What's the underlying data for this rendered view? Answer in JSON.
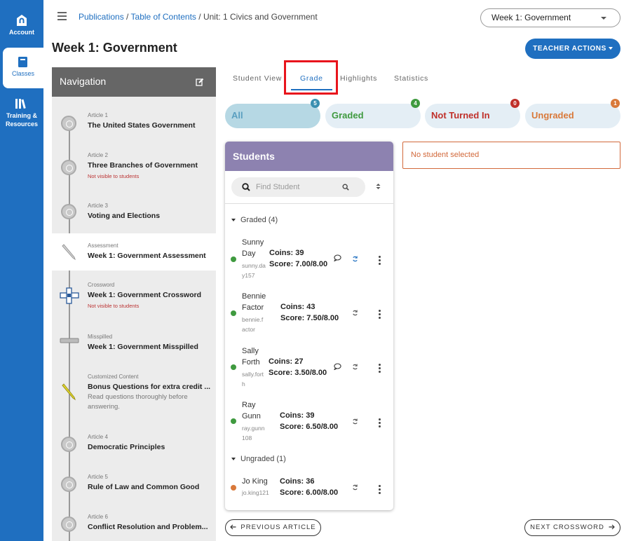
{
  "rail": {
    "items": [
      {
        "label": "Account",
        "icon": "account-icon"
      },
      {
        "label": "Classes",
        "icon": "book-icon"
      },
      {
        "label": "Training & Resources",
        "icon": "books-icon"
      }
    ]
  },
  "header": {
    "breadcrumb": {
      "link1": "Publications",
      "sep1": " / ",
      "link2": "Table of Contents",
      "sep2": " / ",
      "current": "Unit: 1 Civics and Government"
    },
    "week_select": "Week 1: Government",
    "page_title": "Week 1: Government",
    "teacher_actions": "TEACHER ACTIONS"
  },
  "navigation": {
    "title": "Navigation",
    "items": [
      {
        "type": "Article 1",
        "title": "The United States Government",
        "icon": "article-icon"
      },
      {
        "type": "Article 2",
        "title": "Three Branches of Government",
        "note": "Not visible to students",
        "icon": "article-icon"
      },
      {
        "type": "Article 3",
        "title": "Voting and Elections",
        "icon": "article-icon"
      },
      {
        "type": "Assessment",
        "title": "Week 1: Government Assessment",
        "icon": "pencil-icon"
      },
      {
        "type": "Crossword",
        "title": "Week 1: Government Crossword",
        "note": "Not visible to students",
        "icon": "crossword-icon"
      },
      {
        "type": "Misspilled",
        "title": "Week 1: Government Misspilled",
        "icon": "misspilled-icon"
      },
      {
        "type": "Customized Content",
        "title": "Bonus Questions for extra credit ...",
        "desc": "Read questions thoroughly before answering.",
        "icon": "yellow-pencil-icon"
      },
      {
        "type": "Article 4",
        "title": "Democratic Principles",
        "icon": "article-icon"
      },
      {
        "type": "Article 5",
        "title": "Rule of Law and Common Good",
        "icon": "article-icon"
      },
      {
        "type": "Article 6",
        "title": "Conflict Resolution and Problem...",
        "icon": "article-icon"
      }
    ]
  },
  "tabs": [
    "Student View",
    "Grade",
    "Highlights",
    "Statistics"
  ],
  "filters": [
    {
      "label": "All",
      "count": "5",
      "color": "#5a9fc0",
      "badge_color": "#3a8fb0"
    },
    {
      "label": "Graded",
      "count": "4",
      "color": "#3f9a3f",
      "badge_color": "#3f9a3f"
    },
    {
      "label": "Not Turned In",
      "count": "0",
      "color": "#c0302a",
      "badge_color": "#c0302a"
    },
    {
      "label": "Ungraded",
      "count": "1",
      "color": "#d9793a",
      "badge_color": "#d9793a"
    }
  ],
  "students": {
    "title": "Students",
    "search_placeholder": "Find Student",
    "groups": [
      {
        "label": "Graded (4)"
      },
      {
        "label": "Ungraded (1)"
      }
    ],
    "rows": [
      {
        "name": "Sunny Day",
        "username": "sunny.day157",
        "coins": "Coins: 39",
        "score": "Score: 7.00/8.00",
        "status_color": "#3f9a3f"
      },
      {
        "name": "Bennie Factor",
        "username": "bennie.factor",
        "coins": "Coins: 43",
        "score": "Score: 7.50/8.00",
        "status_color": "#3f9a3f"
      },
      {
        "name": "Sally Forth",
        "username": "sally.forth",
        "coins": "Coins: 27",
        "score": "Score: 3.50/8.00",
        "status_color": "#3f9a3f"
      },
      {
        "name": "Ray Gunn",
        "username": "ray.gunn108",
        "coins": "Coins: 39",
        "score": "Score: 6.50/8.00",
        "status_color": "#3f9a3f"
      },
      {
        "name": "Jo King",
        "username": "jo.king121",
        "coins": "Coins: 36",
        "score": "Score: 6.00/8.00",
        "status_color": "#d9793a"
      }
    ]
  },
  "detail": {
    "empty_text": "No student selected"
  },
  "footer": {
    "prev": "PREVIOUS ARTICLE",
    "next": "NEXT CROSSWORD"
  }
}
